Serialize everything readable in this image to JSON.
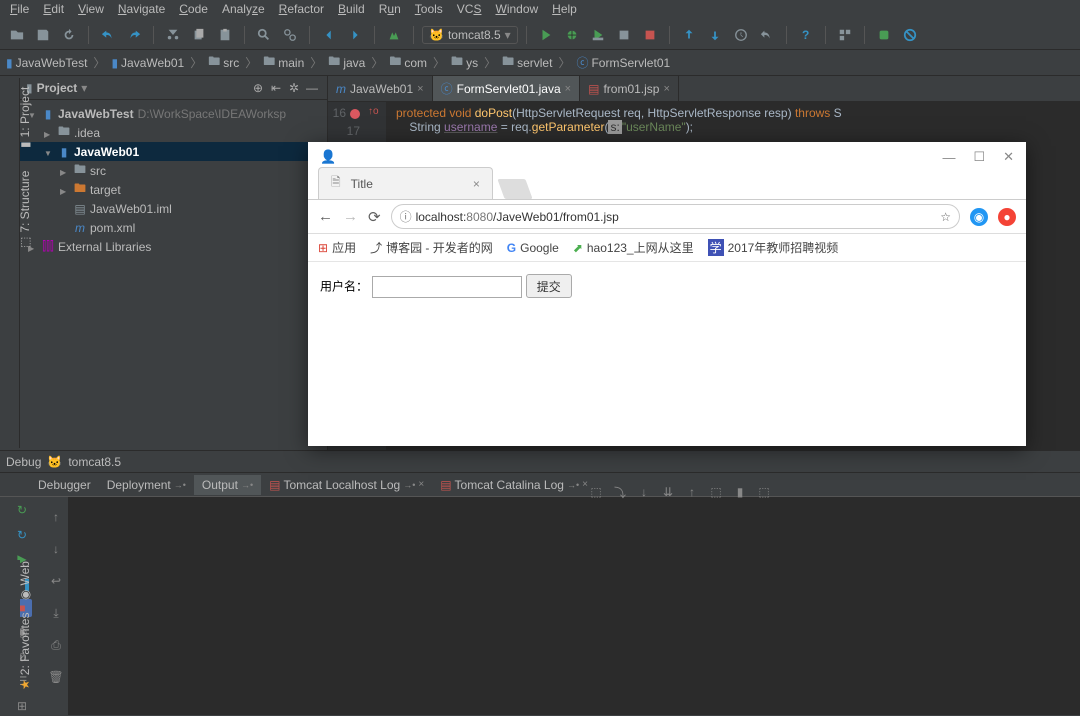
{
  "menu": {
    "items": [
      "File",
      "Edit",
      "View",
      "Navigate",
      "Code",
      "Analyze",
      "Refactor",
      "Build",
      "Run",
      "Tools",
      "VCS",
      "Window",
      "Help"
    ]
  },
  "runConfig": "tomcat8.5",
  "breadcrumbs": [
    "JavaWebTest",
    "JavaWeb01",
    "src",
    "main",
    "java",
    "com",
    "ys",
    "servlet",
    "FormServlet01"
  ],
  "projectPanel": {
    "title": "Project"
  },
  "tree": {
    "root": {
      "label": "JavaWebTest",
      "path": "D:\\WorkSpace\\IDEAWorksp"
    },
    "idea": ".idea",
    "module": "JavaWeb01",
    "src": "src",
    "target": "target",
    "iml": "JavaWeb01.iml",
    "pom": "pom.xml",
    "ext": "External Libraries"
  },
  "editorTabs": [
    {
      "label": "JavaWeb01",
      "icon": "m",
      "iconColor": "#4a88c7"
    },
    {
      "label": "FormServlet01.java",
      "icon": "c",
      "iconColor": "#4a88c7",
      "active": true
    },
    {
      "label": "from01.jsp",
      "icon": "jsp",
      "iconColor": "#c75450"
    }
  ],
  "code": {
    "line16": "16",
    "line17": "17",
    "l16": {
      "kw1": "protected",
      "kw2": "void",
      "method": "doPost",
      "p1": "(",
      "t1": "HttpServletRequest",
      "a1": " req, ",
      "t2": "HttpServletResponse",
      "a2": " resp) ",
      "kw3": "throws",
      "tail": " S"
    },
    "l17": {
      "t": "String ",
      "v": "username",
      "eq": " = req.",
      "m": "getParameter",
      "p": "(",
      "hint": "s:",
      "str": "\"userName\"",
      "end": ");"
    }
  },
  "debug": {
    "title": "Debug",
    "config": "tomcat8.5",
    "tabs": {
      "debugger": "Debugger",
      "deployment": "Deployment",
      "output": "Output",
      "localhost": "Tomcat Localhost Log",
      "catalina": "Tomcat Catalina Log"
    }
  },
  "sideTabs": {
    "project": "1: Project",
    "structure": "7: Structure",
    "web": "Web",
    "favorites": "2: Favorites"
  },
  "browser": {
    "tabTitle": "Title",
    "url": {
      "host": "localhost:",
      "port": "8080",
      "path": "/JaveWeb01/from01.jsp"
    },
    "bookmarks": {
      "apps": "应用",
      "blog": "博客园 - 开发者的网",
      "google": "Google",
      "hao123": "hao123_上网从这里",
      "teach": "2017年教师招聘视频"
    },
    "form": {
      "label": "用户名：",
      "submit": "提交"
    }
  }
}
